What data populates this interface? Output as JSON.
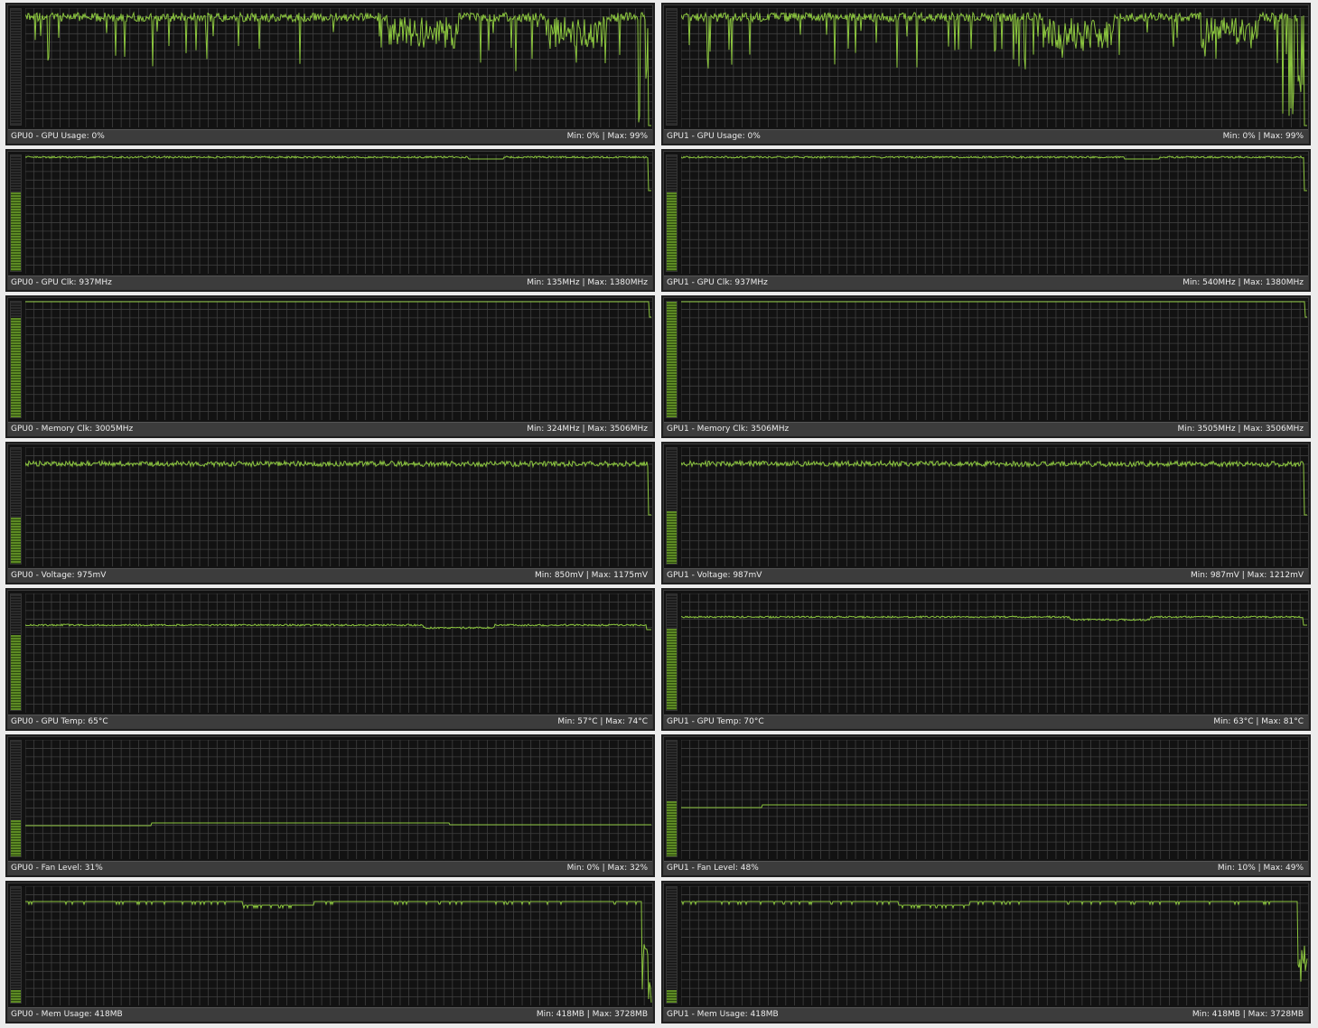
{
  "panels": [
    {
      "status": "GPU0 - GPU Usage: 0%",
      "range": "Min: 0% | Max: 99%",
      "color": "#8cc63f",
      "level": 0.0,
      "line": "spiky_high",
      "seed": 11
    },
    {
      "status": "GPU1 - GPU Usage: 0%",
      "range": "Min: 0% | Max: 99%",
      "color": "#8cc63f",
      "level": 0.0,
      "line": "spiky_high",
      "seed": 23
    },
    {
      "status": "GPU0 - GPU Clk: 937MHz",
      "range": "Min: 135MHz | Max: 1380MHz",
      "color": "#8cc63f",
      "level": 0.68,
      "line": "flat_top",
      "seed": 37
    },
    {
      "status": "GPU1 - GPU Clk: 937MHz",
      "range": "Min: 540MHz | Max: 1380MHz",
      "color": "#8cc63f",
      "level": 0.68,
      "line": "flat_top",
      "seed": 41
    },
    {
      "status": "GPU0 - Memory Clk: 3005MHz",
      "range": "Min: 324MHz | Max: 3506MHz",
      "color": "#8cc63f",
      "level": 0.86,
      "line": "max_line",
      "seed": 53
    },
    {
      "status": "GPU1 - Memory Clk: 3506MHz",
      "range": "Min: 3505MHz | Max: 3506MHz",
      "color": "#8cc63f",
      "level": 1.0,
      "line": "max_line",
      "seed": 59
    },
    {
      "status": "GPU0 - Voltage: 975mV",
      "range": "Min: 850mV | Max: 1175mV",
      "color": "#8cc63f",
      "level": 0.4,
      "line": "steppy",
      "seed": 61
    },
    {
      "status": "GPU1 - Voltage: 987mV",
      "range": "Min: 987mV | Max: 1212mV",
      "color": "#8cc63f",
      "level": 0.45,
      "line": "steppy",
      "seed": 71
    },
    {
      "status": "GPU0 - GPU Temp: 65°C",
      "range": "Min: 57°C | Max: 74°C",
      "color": "#8cc63f",
      "level": 0.65,
      "line": "temp0",
      "seed": 83
    },
    {
      "status": "GPU1 - GPU Temp: 70°C",
      "range": "Min: 63°C | Max: 81°C",
      "color": "#8cc63f",
      "level": 0.7,
      "line": "temp1",
      "seed": 89
    },
    {
      "status": "GPU0 - Fan Level: 31%",
      "range": "Min: 0% | Max: 32%",
      "color": "#8cc63f",
      "level": 0.31,
      "line": "fan0",
      "seed": 97
    },
    {
      "status": "GPU1 - Fan Level: 48%",
      "range": "Min: 10% | Max: 49%",
      "color": "#8cc63f",
      "level": 0.48,
      "line": "fan1",
      "seed": 101
    },
    {
      "status": "GPU0 - Mem Usage: 418MB",
      "range": "Min: 418MB | Max: 3728MB",
      "color": "#8cc63f",
      "level": 0.11,
      "line": "mem",
      "seed": 103
    },
    {
      "status": "GPU1 - Mem Usage: 418MB",
      "range": "Min: 418MB | Max: 3728MB",
      "color": "#8cc63f",
      "level": 0.11,
      "line": "mem",
      "seed": 107
    }
  ]
}
